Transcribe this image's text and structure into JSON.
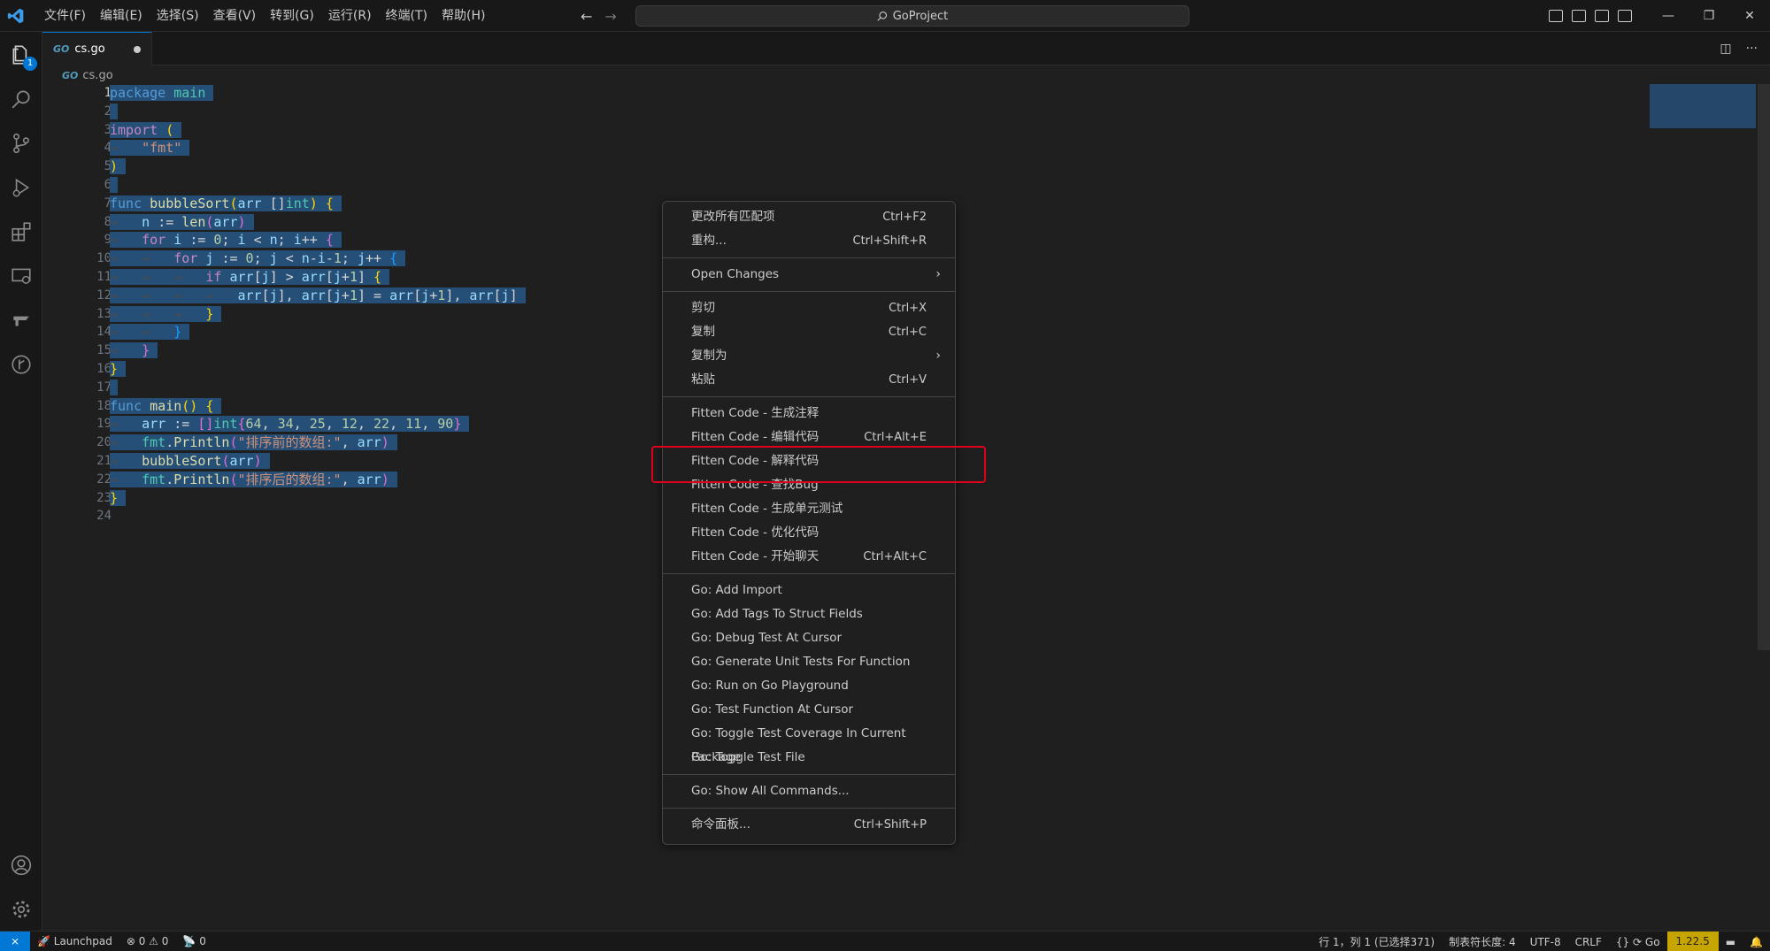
{
  "menubar": {
    "items": [
      "文件(F)",
      "编辑(E)",
      "选择(S)",
      "查看(V)",
      "转到(G)",
      "运行(R)",
      "终端(T)",
      "帮助(H)"
    ]
  },
  "command_center": {
    "label": "GoProject"
  },
  "activity": {
    "explorer_badge": "1"
  },
  "tab": {
    "label": "cs.go",
    "icon_text": "GO"
  },
  "breadcrumb": {
    "file": "cs.go"
  },
  "editor": {
    "line_numbers": [
      "1",
      "2",
      "3",
      "4",
      "5",
      "6",
      "7",
      "8",
      "9",
      "10",
      "11",
      "12",
      "13",
      "14",
      "15",
      "16",
      "17",
      "18",
      "19",
      "20",
      "21",
      "22",
      "23",
      "24"
    ]
  },
  "context_menu": {
    "items": [
      {
        "label": "更改所有匹配项",
        "shortcut": "Ctrl+F2"
      },
      {
        "label": "重构...",
        "shortcut": "Ctrl+Shift+R"
      },
      {
        "label": "Open Changes",
        "shortcut": ""
      },
      {
        "label": "剪切",
        "shortcut": "Ctrl+X"
      },
      {
        "label": "复制",
        "shortcut": "Ctrl+C"
      },
      {
        "label": "复制为",
        "shortcut": ""
      },
      {
        "label": "粘贴",
        "shortcut": "Ctrl+V"
      },
      {
        "label": "Fitten Code - 生成注释",
        "shortcut": ""
      },
      {
        "label": "Fitten Code - 编辑代码",
        "shortcut": "Ctrl+Alt+E"
      },
      {
        "label": "Fitten Code - 解释代码",
        "shortcut": ""
      },
      {
        "label": "Fitten Code - 查找Bug",
        "shortcut": ""
      },
      {
        "label": "Fitten Code - 生成单元测试",
        "shortcut": ""
      },
      {
        "label": "Fitten Code - 优化代码",
        "shortcut": ""
      },
      {
        "label": "Fitten Code - 开始聊天",
        "shortcut": "Ctrl+Alt+C"
      },
      {
        "label": "Go: Add Import",
        "shortcut": ""
      },
      {
        "label": "Go: Add Tags To Struct Fields",
        "shortcut": ""
      },
      {
        "label": "Go: Debug Test At Cursor",
        "shortcut": ""
      },
      {
        "label": "Go: Generate Unit Tests For Function",
        "shortcut": ""
      },
      {
        "label": "Go: Run on Go Playground",
        "shortcut": ""
      },
      {
        "label": "Go: Test Function At Cursor",
        "shortcut": ""
      },
      {
        "label": "Go: Toggle Test Coverage In Current Package",
        "shortcut": ""
      },
      {
        "label": "Go: Toggle Test File",
        "shortcut": ""
      },
      {
        "label": "Go: Show All Commands...",
        "shortcut": ""
      },
      {
        "label": "命令面板...",
        "shortcut": "Ctrl+Shift+P"
      }
    ]
  },
  "statusbar": {
    "launchpad": "Launchpad",
    "errors": "0",
    "warnings": "0",
    "ports": "0",
    "position": "行 1，列 1 (已选择371)",
    "tab_size": "制表符长度: 4",
    "encoding": "UTF-8",
    "eol": "CRLF",
    "language": "Go",
    "go_version": "1.22.5"
  }
}
